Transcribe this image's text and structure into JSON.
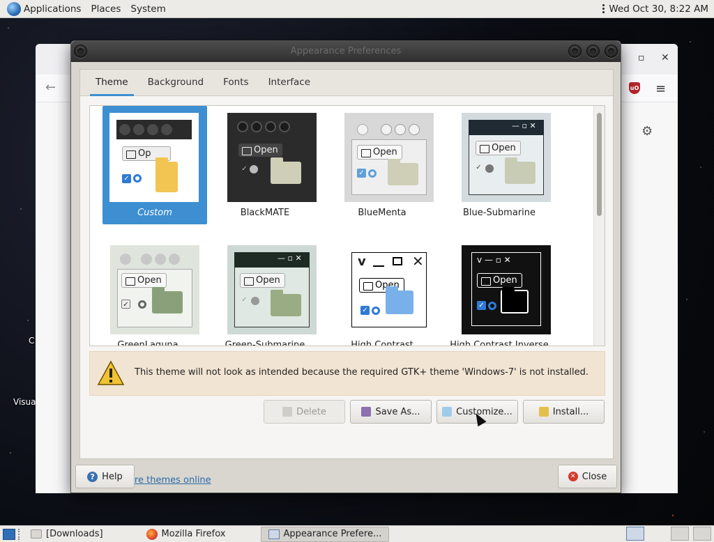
{
  "top_panel": {
    "menus": [
      "Applications",
      "Places",
      "System"
    ],
    "clock": "Wed Oct 30,  8:22 AM"
  },
  "background": {
    "desktop_labels": [
      "C",
      "Visua"
    ]
  },
  "dialog": {
    "title": "Appearance Preferences",
    "tabs": [
      {
        "label": "Theme",
        "active": true
      },
      {
        "label": "Background",
        "active": false
      },
      {
        "label": "Fonts",
        "active": false
      },
      {
        "label": "Interface",
        "active": false
      }
    ],
    "themes": [
      {
        "name": "Custom",
        "selected": true
      },
      {
        "name": "BlackMATE",
        "selected": false
      },
      {
        "name": "BlueMenta",
        "selected": false
      },
      {
        "name": "Blue-Submarine",
        "selected": false
      },
      {
        "name": "GreenLaguna",
        "selected": false
      },
      {
        "name": "Green-Submarine",
        "selected": false
      },
      {
        "name": "High Contrast",
        "selected": false
      },
      {
        "name": "High Contrast Inverse",
        "selected": false
      }
    ],
    "preview_open_label": "Open",
    "preview_open_label_partial": "Op",
    "warning": "This theme will not look as intended because the required GTK+ theme 'Windows-7' is not installed.",
    "buttons": {
      "delete": "Delete",
      "save_as": "Save As...",
      "customize": "Customize...",
      "install": "Install..."
    },
    "more_link": "Get more themes online",
    "help": "Help",
    "close": "Close"
  },
  "taskbar": {
    "tasks": [
      {
        "label": "[Downloads]",
        "active": false
      },
      {
        "label": "Mozilla Firefox",
        "active": false
      },
      {
        "label": "Appearance Prefere...",
        "active": true
      }
    ]
  },
  "colors": {
    "selection": "#3d8fd1",
    "warning_bg": "#f1e4d2",
    "link": "#2b6aa8"
  }
}
